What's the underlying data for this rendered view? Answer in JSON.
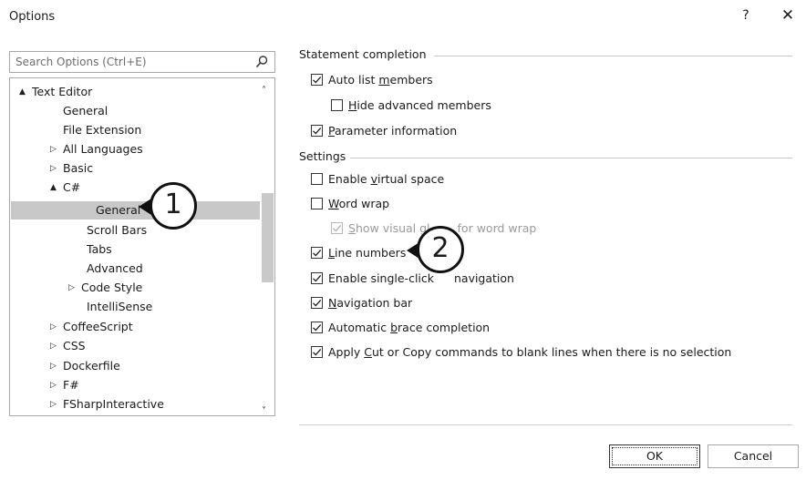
{
  "window": {
    "title": "Options",
    "help_label": "?",
    "close_label": "✕"
  },
  "search": {
    "placeholder": "Search Options (Ctrl+E)",
    "icon": "search-icon"
  },
  "tree": {
    "items": [
      {
        "label": "Text Editor",
        "expander": "▲"
      },
      {
        "label": "General",
        "expander": ""
      },
      {
        "label": "File Extension",
        "expander": ""
      },
      {
        "label": "All Languages",
        "expander": "▷"
      },
      {
        "label": "Basic",
        "expander": "▷"
      },
      {
        "label": "C#",
        "expander": "▲"
      },
      {
        "label": "General",
        "expander": "",
        "selected": true
      },
      {
        "label": "Scroll Bars",
        "expander": ""
      },
      {
        "label": "Tabs",
        "expander": ""
      },
      {
        "label": "Advanced",
        "expander": ""
      },
      {
        "label": "Code Style",
        "expander": "▷"
      },
      {
        "label": "IntelliSense",
        "expander": ""
      },
      {
        "label": "CoffeeScript",
        "expander": "▷"
      },
      {
        "label": "CSS",
        "expander": "▷"
      },
      {
        "label": "Dockerfile",
        "expander": "▷"
      },
      {
        "label": "F#",
        "expander": "▷"
      },
      {
        "label": "FSharpInteractive",
        "expander": "▷"
      }
    ]
  },
  "callouts": {
    "one": "1",
    "two": "2"
  },
  "statement_completion": {
    "header": "Statement completion",
    "options": [
      {
        "before": "Auto list ",
        "key": "m",
        "after": "embers",
        "checked": true,
        "enabled": true
      },
      {
        "before": "",
        "key": "H",
        "after": "ide advanced members",
        "checked": false,
        "enabled": true
      },
      {
        "before": "",
        "key": "P",
        "after": "arameter information",
        "checked": true,
        "enabled": true
      }
    ]
  },
  "settings": {
    "header": "Settings",
    "options": [
      {
        "before": "Enable ",
        "key": "v",
        "after": "irtual space",
        "checked": false,
        "enabled": true
      },
      {
        "before": "",
        "key": "W",
        "after": "ord wrap",
        "checked": false,
        "enabled": true
      },
      {
        "before": "",
        "key": "S",
        "after": "how visual gl",
        "after2": "for word wrap",
        "checked": true,
        "enabled": false
      },
      {
        "before": "",
        "key": "L",
        "after": "ine numbers",
        "checked": true,
        "enabled": true
      },
      {
        "before": "Enable single-click ",
        "key": "",
        "after": "",
        "after2": "navigation",
        "checked": true,
        "enabled": true
      },
      {
        "before": "",
        "key": "N",
        "after": "avigation bar",
        "checked": true,
        "enabled": true
      },
      {
        "before": "Automatic ",
        "key": "b",
        "after": "race completion",
        "checked": true,
        "enabled": true
      },
      {
        "before": "Apply ",
        "key": "C",
        "after": "ut or Copy commands to blank lines when there is no selection",
        "checked": true,
        "enabled": true
      }
    ]
  },
  "buttons": {
    "ok": "OK",
    "cancel": "Cancel"
  }
}
